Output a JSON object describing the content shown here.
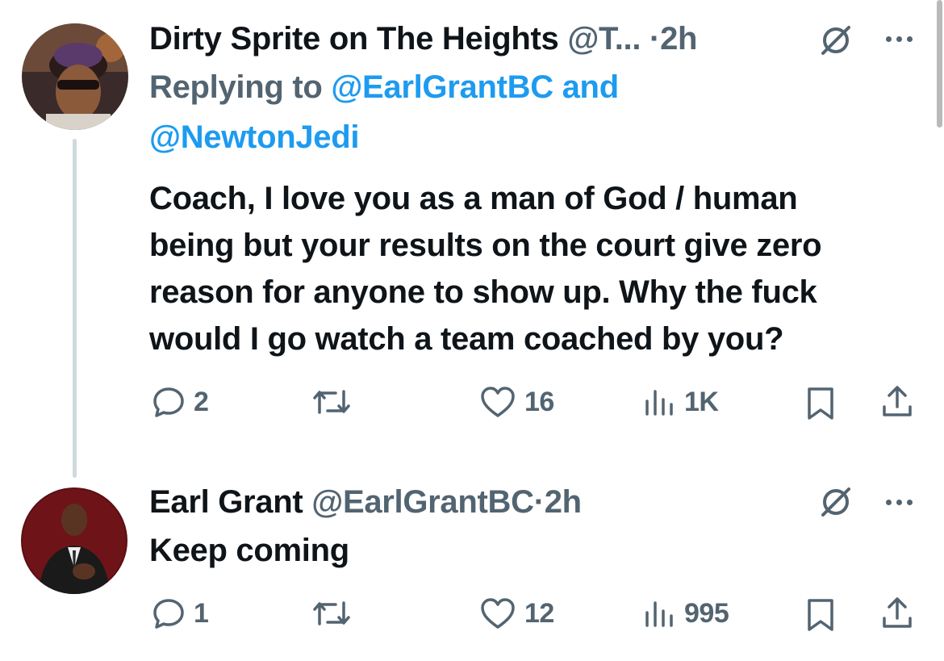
{
  "tweet1": {
    "display_name": "Dirty Sprite on The Heights",
    "handle": "@T...",
    "separator": "·",
    "time": "2h",
    "replying_prefix": "Replying to",
    "reply_to_1": "@EarlGrantBC",
    "reply_and": "and",
    "reply_to_2": "@NewtonJedi",
    "text_lines": [
      "Coach, I love you as a man of God / human",
      "being but your results on the court give zero",
      "reason for anyone to show up. Why the fuck",
      "would I go watch a team coached by you?"
    ],
    "replies": "2",
    "likes": "16",
    "views": "1K",
    "icons": [
      "grok-icon",
      "more-icon",
      "reply-icon",
      "retweet-icon",
      "like-icon",
      "views-icon",
      "bookmark-icon",
      "share-icon"
    ]
  },
  "tweet2": {
    "display_name": "Earl Grant",
    "handle": "@EarlGrantBC",
    "separator": "·",
    "time": "2h",
    "text": "Keep coming",
    "replies": "1",
    "likes": "12",
    "views": "995"
  },
  "colors": {
    "text": "#0f1419",
    "muted": "#536471",
    "link": "#1d9bf0",
    "thread_line": "#cfd9de"
  }
}
